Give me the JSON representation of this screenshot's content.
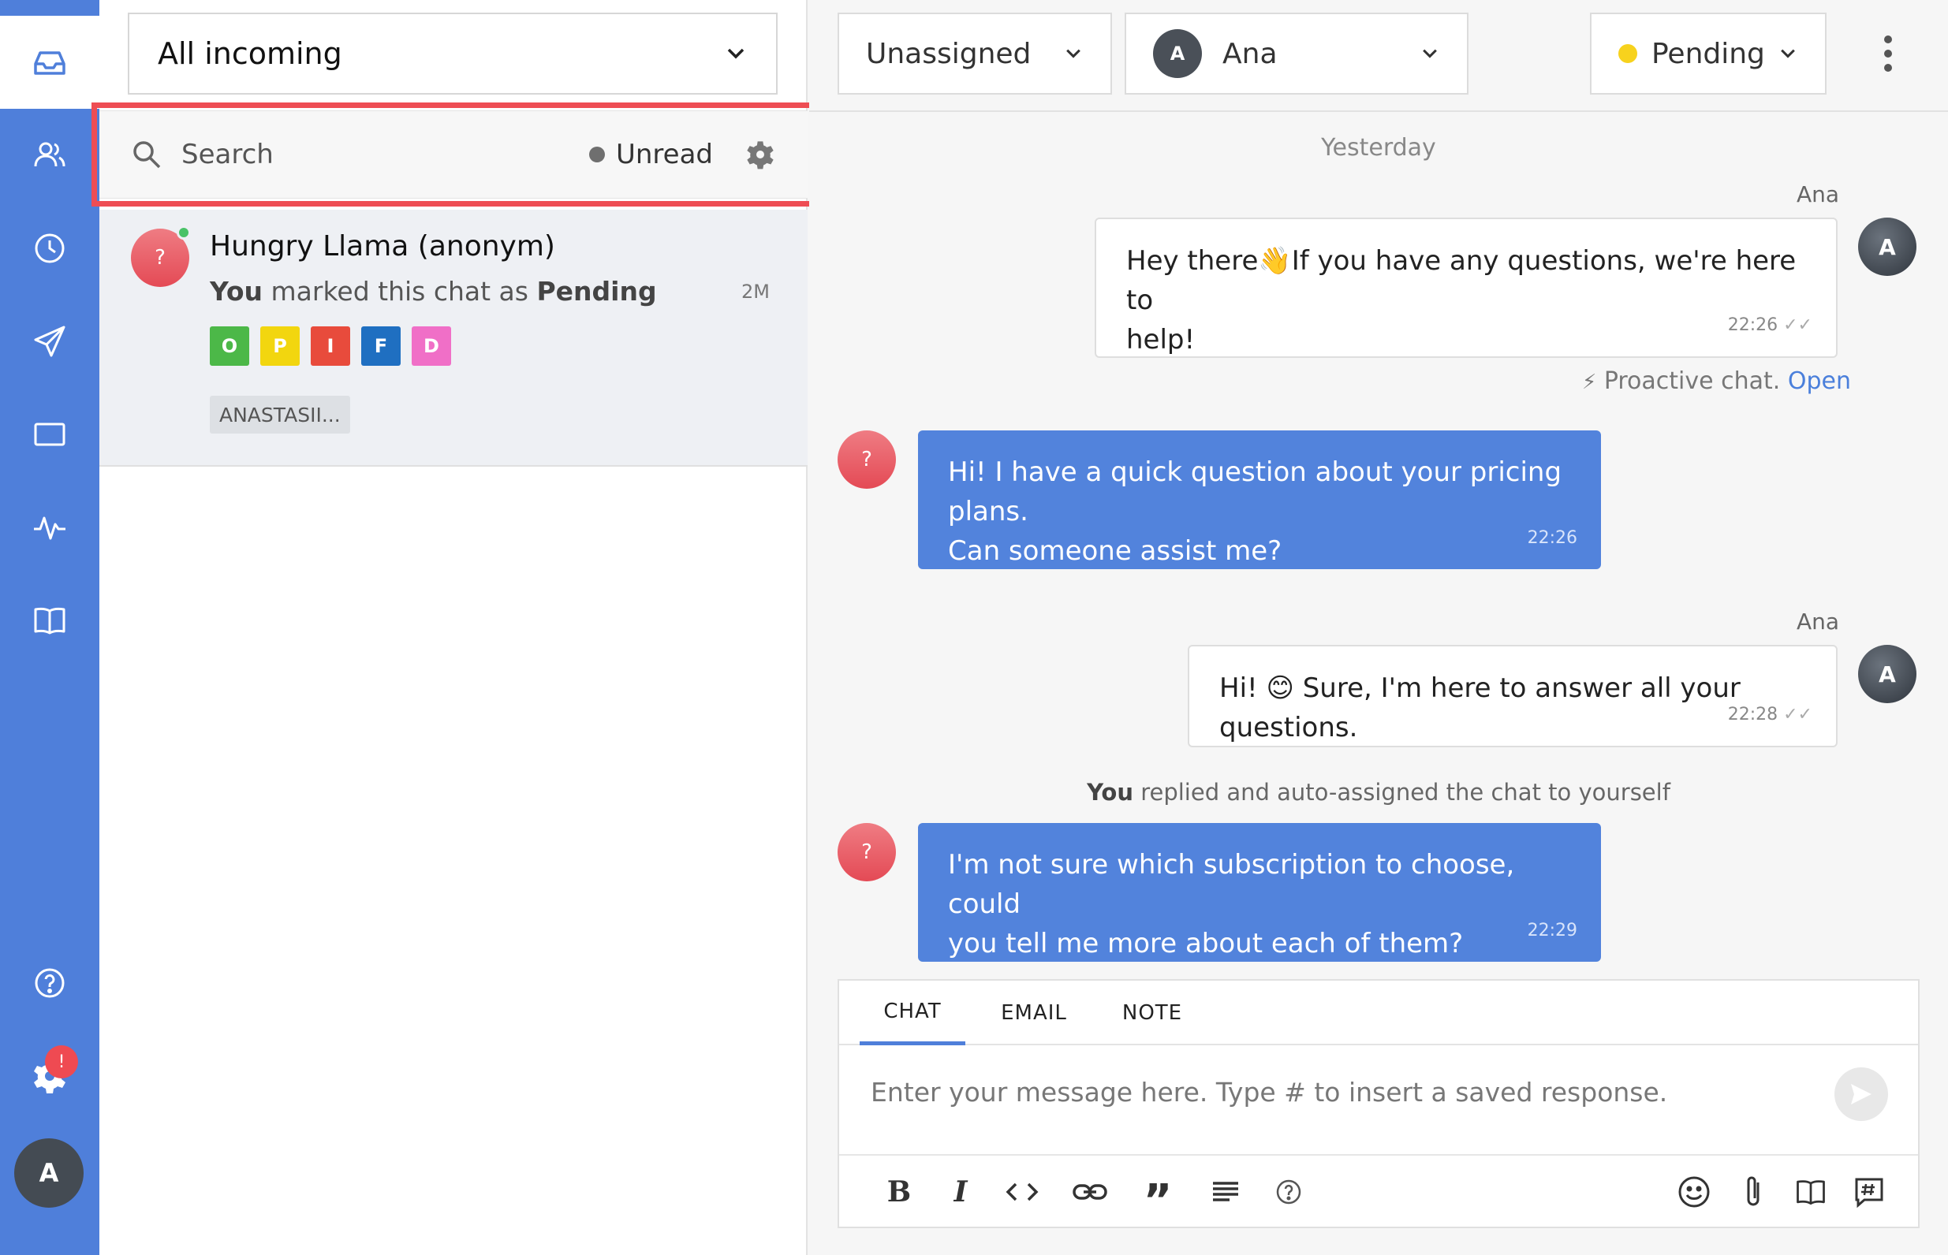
{
  "sidebar": {
    "nav_items": [
      "inbox",
      "customers",
      "history",
      "campaigns",
      "archive",
      "reports",
      "knowledge-base"
    ],
    "settings_badge": "!",
    "user_initial": "A"
  },
  "chat_list": {
    "inbox_filter": "All incoming",
    "search_placeholder": "Search",
    "unread_label": "Unread",
    "items": [
      {
        "avatar_glyph": "?",
        "name": "Hungry Llama (anonym)",
        "preview_actor": "You",
        "preview_middle": " marked this chat as ",
        "preview_status": "Pending",
        "time": "2M",
        "tags": [
          {
            "letter": "O",
            "color": "#4cb848"
          },
          {
            "letter": "P",
            "color": "#f2d60f"
          },
          {
            "letter": "I",
            "color": "#e84b3c"
          },
          {
            "letter": "F",
            "color": "#1f6fc1"
          },
          {
            "letter": "D",
            "color": "#f06fc7"
          }
        ],
        "agent_tag": "ANASTASII..."
      }
    ]
  },
  "conversation": {
    "assign_dropdown": "Unassigned",
    "agent_dropdown": {
      "initial": "A",
      "name": "Ana"
    },
    "status_dropdown": "Pending",
    "day_separator": "Yesterday",
    "messages": [
      {
        "type": "agent",
        "sender": "Ana",
        "avatar": "A",
        "line1": "Hey there👋If you have any questions, we're here to",
        "line2": "help!",
        "time": "22:26"
      },
      {
        "type": "visitor",
        "avatar": "?",
        "line1": "Hi! I have a quick question about your pricing plans.",
        "line2": "Can someone assist me?",
        "time": "22:26"
      },
      {
        "type": "agent",
        "sender": "Ana",
        "avatar": "A",
        "line1": "Hi! 😊 Sure, I'm here to answer all your questions.",
        "time": "22:28"
      },
      {
        "type": "visitor",
        "avatar": "?",
        "line1": "I'm not sure which subscription to choose, could",
        "line2": "you tell me more about each of them?",
        "time": "22:29"
      }
    ],
    "proactive_text": "Proactive chat.",
    "proactive_link": "Open",
    "system_actor": "You",
    "system_text": " replied and auto-assigned the chat to yourself"
  },
  "composer": {
    "tabs": [
      "CHAT",
      "EMAIL",
      "NOTE"
    ],
    "placeholder": "Enter your message here. Type # to insert a saved response.",
    "toolbar_left": [
      "bold-icon",
      "italic-icon",
      "code-icon",
      "link-icon",
      "quote-icon",
      "list-icon",
      "help-icon"
    ],
    "toolbar_right": [
      "emoji-icon",
      "attachment-icon",
      "canned-responses-icon",
      "hashtag-icon"
    ]
  },
  "colors": {
    "rail": "#4f7fda",
    "visitor_bubble": "#5283dc",
    "highlight": "#ee4d54",
    "pending_dot": "#f7d21d"
  }
}
